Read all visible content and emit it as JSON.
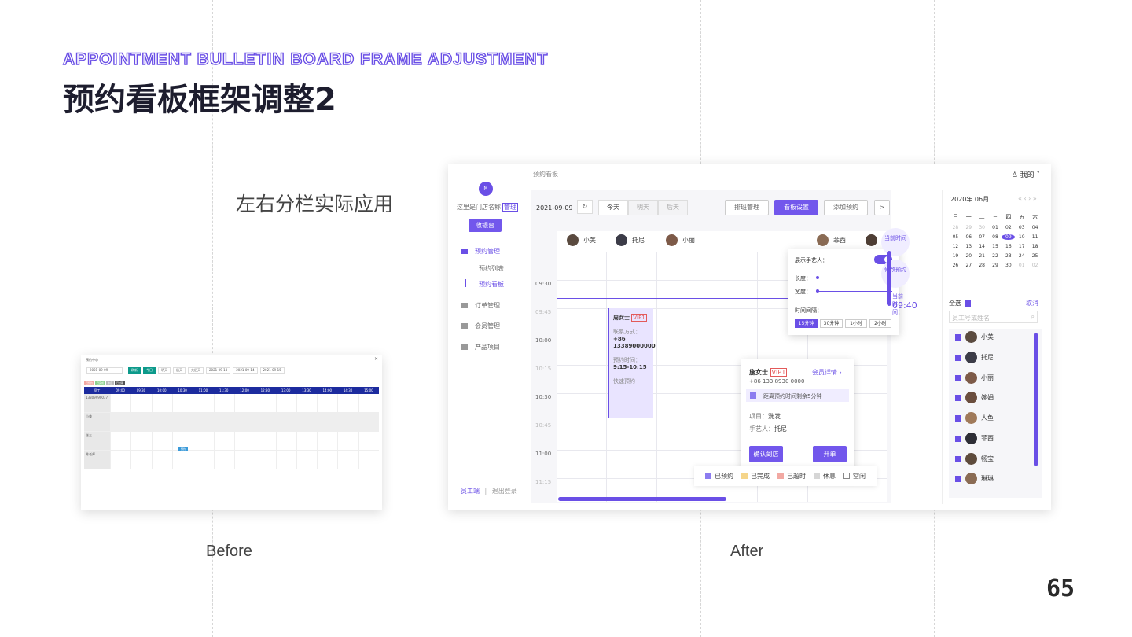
{
  "slide": {
    "en_title": "APPOINTMENT BULLETIN BOARD FRAME ADJUSTMENT",
    "cn_title": "预约看板框架调整2",
    "subtitle": "左右分栏实际应用",
    "caption_before": "Before",
    "caption_after": "After",
    "page_number": "65",
    "accent_color": "#6a4fe6"
  },
  "before": {
    "window_title": "预约中心",
    "close": "×",
    "date": "2021-09-09",
    "buttons": [
      "刷新",
      "今日",
      "明天",
      "后天",
      "大后天",
      "2021-09-13",
      "2021-09-14",
      "2021-09-15"
    ],
    "legend": [
      "已预约",
      "已完成",
      "休息",
      "已过期"
    ],
    "columns": [
      "员工",
      "09:00",
      "09:30",
      "10:00",
      "10:30",
      "11:00",
      "11:30",
      "12:00",
      "12:30",
      "13:00",
      "13:30",
      "14:00",
      "14:30",
      "15:00"
    ],
    "rows": [
      "13309990037",
      "小美",
      "张三",
      "陈老师"
    ],
    "appointment_label": "预约"
  },
  "after": {
    "breadcrumb": "预约看板",
    "user": "我的",
    "sidebar": {
      "logo": "M",
      "store_name": "这里是门店名称",
      "store_tag": "管理",
      "cashier_button": "收银台",
      "items": [
        "预约管理",
        "订单管理",
        "会员管理",
        "产品项目"
      ],
      "sub_items": [
        "预约列表",
        "预约看板"
      ],
      "footer_left": "员工端",
      "footer_sep": "|",
      "footer_right": "退出登录"
    },
    "toolbar": {
      "date": "2021-09-09",
      "refresh": "↻",
      "day_tabs": [
        "今天",
        "明天",
        "后天"
      ],
      "buttons": [
        "排班管理",
        "看板设置",
        "添加预约"
      ],
      "next": ">"
    },
    "staff": [
      "小美",
      "托尼",
      "小丽",
      "菲西"
    ],
    "time_labels": [
      "09:30",
      "09:45",
      "10:00",
      "10:15",
      "10:30",
      "10:45",
      "11:00",
      "11:15"
    ],
    "appointment": {
      "name": "周女士",
      "vip": "VIP1",
      "contact_label": "联系方式：",
      "phone": "+86 13389000000",
      "time_label": "预约时间：",
      "time": "9:15-10:15",
      "note": "快速预约"
    },
    "popup": {
      "name": "施女士",
      "vip": "VIP1",
      "link": "会员详情",
      "phone": "+86 133 8930 0000",
      "notice": "距离预约时间剩余5分钟",
      "service_label": "项目：",
      "service": "洗发",
      "staff_label": "手艺人：",
      "staff": "托尼",
      "confirm": "确认到店",
      "start": "开单"
    },
    "settings": {
      "show_label": "展示手艺人：",
      "length_label": "长度：",
      "width_label": "宽度：",
      "interval_label": "时间间隔：",
      "intervals": [
        "15分钟",
        "30分钟",
        "1小时",
        "2小时"
      ]
    },
    "side_buttons": [
      "当前时间",
      "修改预约"
    ],
    "current_time_label": "当前时间：",
    "current_time": "09:40",
    "legend": [
      "已预约",
      "已完成",
      "已超时",
      "休息",
      "空闲"
    ],
    "legend_colors": [
      "#8c7cf0",
      "#f5d58a",
      "#f2a9a3",
      "#d6d6d6",
      "#ffffff"
    ],
    "calendar": {
      "month": "2020年 06月",
      "nav": "« ‹  › »",
      "weekdays": [
        "日",
        "一",
        "二",
        "三",
        "四",
        "五",
        "六"
      ],
      "days": [
        "28",
        "29",
        "30",
        "01",
        "02",
        "03",
        "04",
        "05",
        "06",
        "07",
        "08",
        "09",
        "10",
        "11",
        "12",
        "13",
        "14",
        "15",
        "16",
        "17",
        "18",
        "19",
        "20",
        "21",
        "22",
        "23",
        "24",
        "25",
        "26",
        "27",
        "28",
        "29",
        "30",
        "01",
        "02"
      ],
      "selected": "09"
    },
    "staff_panel": {
      "select_all": "全选",
      "cancel": "取消",
      "search_placeholder": "员工号或姓名",
      "list": [
        "小美",
        "托尼",
        "小丽",
        "婉娟",
        "人鱼",
        "菲西",
        "畅宝",
        "琳琳"
      ]
    }
  }
}
